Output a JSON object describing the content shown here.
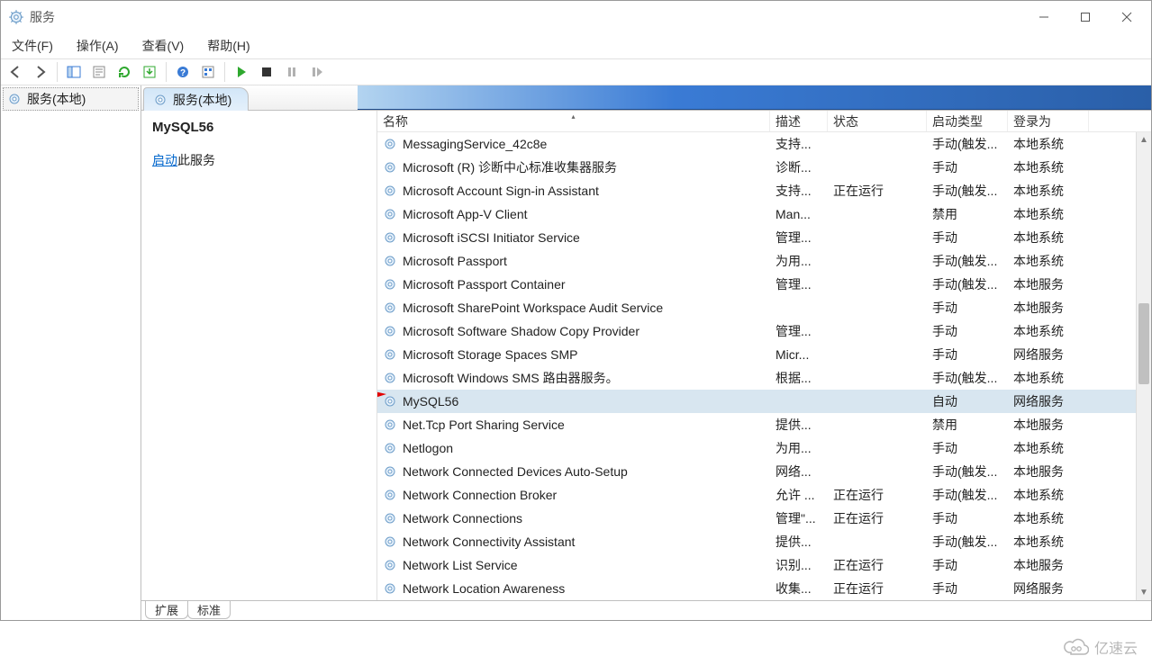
{
  "window": {
    "title": "服务"
  },
  "menu": {
    "file": "文件(F)",
    "action": "操作(A)",
    "view": "查看(V)",
    "help": "帮助(H)"
  },
  "tree": {
    "root_label": "服务(本地)"
  },
  "tab": {
    "label": "服务(本地)"
  },
  "desc": {
    "service_name": "MySQL56",
    "action_link": "启动",
    "action_suffix": "此服务"
  },
  "columns": {
    "name": "名称",
    "desc": "描述",
    "status": "状态",
    "startup": "启动类型",
    "logon": "登录为"
  },
  "bottom_tabs": {
    "extended": "扩展",
    "standard": "标准"
  },
  "watermark": "亿速云",
  "services": [
    {
      "name": "MessagingService_42c8e",
      "desc": "支持...",
      "status": "",
      "startup": "手动(触发...",
      "logon": "本地系统"
    },
    {
      "name": "Microsoft (R) 诊断中心标准收集器服务",
      "desc": "诊断...",
      "status": "",
      "startup": "手动",
      "logon": "本地系统"
    },
    {
      "name": "Microsoft Account Sign-in Assistant",
      "desc": "支持...",
      "status": "正在运行",
      "startup": "手动(触发...",
      "logon": "本地系统"
    },
    {
      "name": "Microsoft App-V Client",
      "desc": "Man...",
      "status": "",
      "startup": "禁用",
      "logon": "本地系统"
    },
    {
      "name": "Microsoft iSCSI Initiator Service",
      "desc": "管理...",
      "status": "",
      "startup": "手动",
      "logon": "本地系统"
    },
    {
      "name": "Microsoft Passport",
      "desc": "为用...",
      "status": "",
      "startup": "手动(触发...",
      "logon": "本地系统"
    },
    {
      "name": "Microsoft Passport Container",
      "desc": "管理...",
      "status": "",
      "startup": "手动(触发...",
      "logon": "本地服务"
    },
    {
      "name": "Microsoft SharePoint Workspace Audit Service",
      "desc": "",
      "status": "",
      "startup": "手动",
      "logon": "本地服务"
    },
    {
      "name": "Microsoft Software Shadow Copy Provider",
      "desc": "管理...",
      "status": "",
      "startup": "手动",
      "logon": "本地系统"
    },
    {
      "name": "Microsoft Storage Spaces SMP",
      "desc": "Micr...",
      "status": "",
      "startup": "手动",
      "logon": "网络服务"
    },
    {
      "name": "Microsoft Windows SMS 路由器服务。",
      "desc": "根据...",
      "status": "",
      "startup": "手动(触发...",
      "logon": "本地系统"
    },
    {
      "name": "MySQL56",
      "desc": "",
      "status": "",
      "startup": "自动",
      "logon": "网络服务",
      "selected": true
    },
    {
      "name": "Net.Tcp Port Sharing Service",
      "desc": "提供...",
      "status": "",
      "startup": "禁用",
      "logon": "本地服务"
    },
    {
      "name": "Netlogon",
      "desc": "为用...",
      "status": "",
      "startup": "手动",
      "logon": "本地系统"
    },
    {
      "name": "Network Connected Devices Auto-Setup",
      "desc": "网络...",
      "status": "",
      "startup": "手动(触发...",
      "logon": "本地服务"
    },
    {
      "name": "Network Connection Broker",
      "desc": "允许 ...",
      "status": "正在运行",
      "startup": "手动(触发...",
      "logon": "本地系统"
    },
    {
      "name": "Network Connections",
      "desc": "管理\"...",
      "status": "正在运行",
      "startup": "手动",
      "logon": "本地系统"
    },
    {
      "name": "Network Connectivity Assistant",
      "desc": "提供...",
      "status": "",
      "startup": "手动(触发...",
      "logon": "本地系统"
    },
    {
      "name": "Network List Service",
      "desc": "识别...",
      "status": "正在运行",
      "startup": "手动",
      "logon": "本地服务"
    },
    {
      "name": "Network Location Awareness",
      "desc": "收集...",
      "status": "正在运行",
      "startup": "手动",
      "logon": "网络服务"
    }
  ]
}
